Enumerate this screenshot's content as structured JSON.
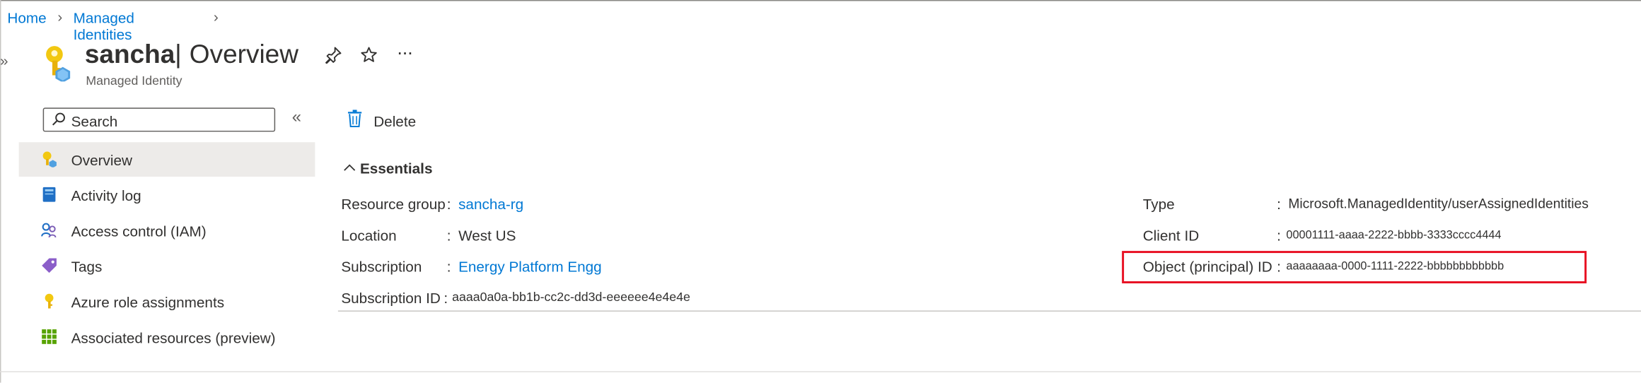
{
  "breadcrumb": {
    "home": "Home",
    "managed_identities": "Managed Identities"
  },
  "header": {
    "resource_name": "sancha",
    "separator": "|",
    "page_name": "Overview",
    "subtitle": "Managed Identity",
    "more": "···"
  },
  "search": {
    "placeholder": "Search"
  },
  "nav": {
    "items": [
      {
        "label": "Overview",
        "icon": "key-identity-icon"
      },
      {
        "label": "Activity log",
        "icon": "activity-log-icon"
      },
      {
        "label": "Access control (IAM)",
        "icon": "people-icon"
      },
      {
        "label": "Tags",
        "icon": "tag-icon"
      },
      {
        "label": "Azure role assignments",
        "icon": "key-icon"
      },
      {
        "label": "Associated resources (preview)",
        "icon": "grid-icon"
      }
    ]
  },
  "toolbar": {
    "delete_label": "Delete"
  },
  "essentials": {
    "title": "Essentials",
    "left": [
      {
        "label": "Resource group",
        "value": "sancha-rg"
      },
      {
        "label": "Location",
        "value": "West US"
      },
      {
        "label": "Subscription",
        "value": "Energy Platform Engg"
      },
      {
        "label": "Subscription ID",
        "value": "aaaa0a0a-bb1b-cc2c-dd3d-eeeeee4e4e4e"
      }
    ],
    "right": [
      {
        "label": "Type",
        "value": "Microsoft.ManagedIdentity/userAssignedIdentities"
      },
      {
        "label": "Client ID",
        "value": "00001111-aaaa-2222-bbbb-3333cccc4444"
      },
      {
        "label": "Object (principal) ID",
        "value": "aaaaaaaa-0000-1111-2222-bbbbbbbbbbbb"
      }
    ]
  },
  "colors": {
    "accent": "#0078d4",
    "highlight_border": "#e81123",
    "selected_nav": "#edebe9"
  }
}
